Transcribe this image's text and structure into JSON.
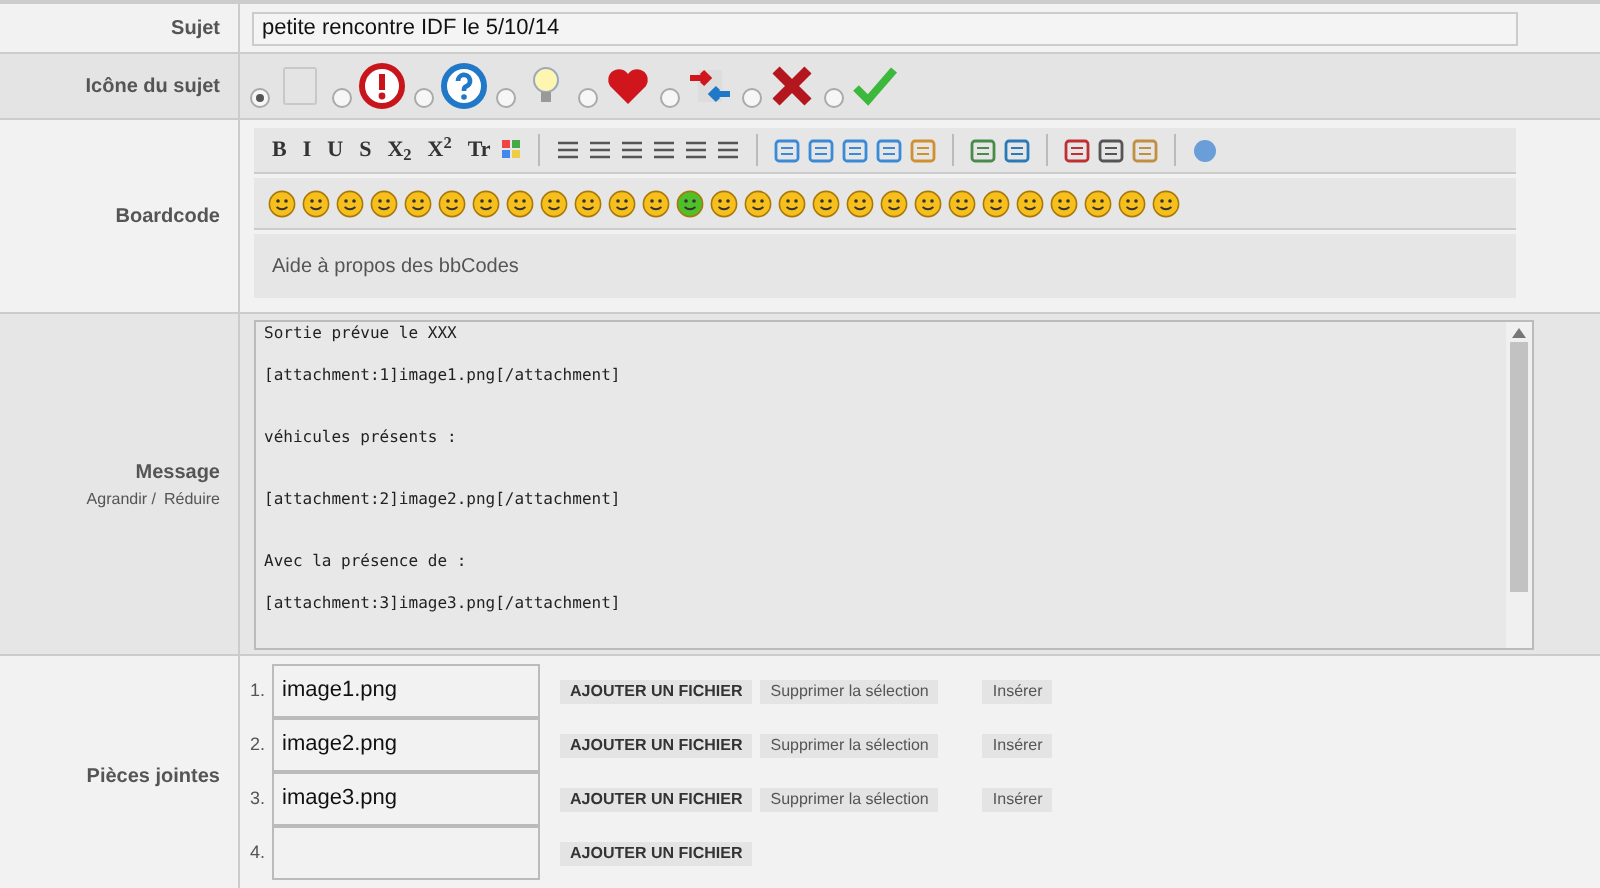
{
  "subject": {
    "label": "Sujet",
    "value": "petite rencontre IDF le 5/10/14"
  },
  "topic_icon": {
    "label": "Icône du sujet",
    "options": [
      {
        "kind": "blank",
        "selected": true
      },
      {
        "kind": "exclamation",
        "selected": false
      },
      {
        "kind": "question",
        "selected": false
      },
      {
        "kind": "bulb",
        "selected": false
      },
      {
        "kind": "heart",
        "selected": false
      },
      {
        "kind": "arrows",
        "selected": false
      },
      {
        "kind": "cross",
        "selected": false
      },
      {
        "kind": "check",
        "selected": false
      }
    ]
  },
  "boardcode": {
    "label": "Boardcode",
    "format_buttons": [
      "B",
      "I",
      "U",
      "S",
      "X$_{2}$",
      "X$^{2}$",
      "Tr"
    ],
    "help_link": "Aide à propos des bbCodes"
  },
  "message": {
    "label": "Message",
    "enlarge_link": "Agrandir /",
    "reduce_link": "Réduire",
    "value": "Sortie prévue le XXX\n\n[attachment:1]image1.png[/attachment]\n\n\nvéhicules présents :\n\n\n[attachment:2]image2.png[/attachment]\n\n\nAvec la présence de :\n\n[attachment:3]image3.png[/attachment]"
  },
  "attachments": {
    "label": "Pièces jointes",
    "rows": [
      {
        "number": "1.",
        "filename": "image1.png",
        "buttons": [
          "AJOUTER UN FICHIER",
          "Supprimer la sélection",
          "Insérer"
        ]
      },
      {
        "number": "2.",
        "filename": "image2.png",
        "buttons": [
          "AJOUTER UN FICHIER",
          "Supprimer la sélection",
          "Insérer"
        ]
      },
      {
        "number": "3.",
        "filename": "image3.png",
        "buttons": [
          "AJOUTER UN FICHIER",
          "Supprimer la sélection",
          "Insérer"
        ]
      },
      {
        "number": "4.",
        "buttons": [
          "AJOUTER UN FICHIER"
        ]
      }
    ]
  }
}
